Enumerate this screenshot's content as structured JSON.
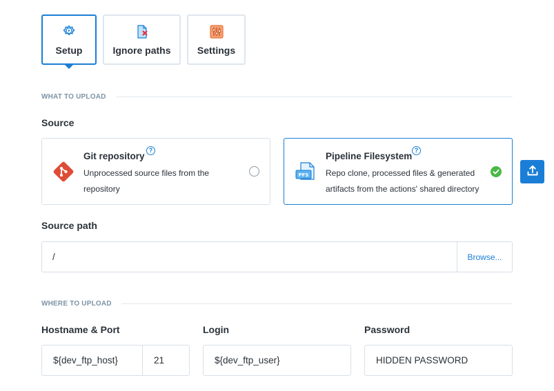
{
  "tabs": [
    {
      "label": "Setup",
      "icon": "setup-gear-play-icon",
      "active": true
    },
    {
      "label": "Ignore paths",
      "icon": "ignore-file-icon",
      "active": false
    },
    {
      "label": "Settings",
      "icon": "settings-sliders-icon",
      "active": false
    }
  ],
  "what_to_upload": {
    "header": "WHAT TO UPLOAD",
    "source_label": "Source",
    "options": [
      {
        "title": "Git repository",
        "description": "Unprocessed source files from the repository",
        "icon": "git-icon",
        "help": "?",
        "selected": false
      },
      {
        "title": "Pipeline Filesystem",
        "description": "Repo clone, processed files & generated artifacts from the actions' shared directory",
        "icon": "pfs-icon",
        "help": "?",
        "selected": true
      }
    ],
    "source_path_label": "Source path",
    "source_path_value": "/",
    "browse_label": "Browse..."
  },
  "where_to_upload": {
    "header": "WHERE TO UPLOAD",
    "hostname_label": "Hostname & Port",
    "hostname_value": "${dev_ftp_host}",
    "port_value": "21",
    "login_label": "Login",
    "login_value": "${dev_ftp_user}",
    "password_label": "Password",
    "password_value": "HIDDEN PASSWORD"
  },
  "colors": {
    "accent": "#1b7ed6",
    "success": "#4cb848",
    "git": "#de4c36",
    "border": "#d6dfe7"
  }
}
